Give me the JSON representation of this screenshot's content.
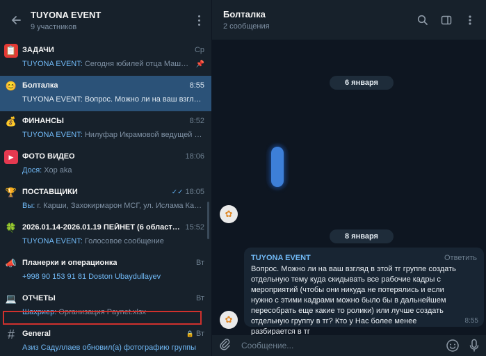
{
  "left_header": {
    "title": "TUYONA EVENT",
    "subtitle": "9 участников"
  },
  "chats": [
    {
      "name": "ЗАДАЧИ",
      "time": "Ср",
      "sender": "TUYONA EVENT:",
      "preview": " Сегодня юбилей отца Машкуро...",
      "icon": "📋",
      "icon_bg": "#e53935"
    },
    {
      "name": "Болталка",
      "time": "8:55",
      "sender": "TUYONA EVENT:",
      "preview": " Вопрос. Можно ли на ваш взгляд...",
      "icon": "😊",
      "icon_bg": "transparent"
    },
    {
      "name": "ФИНАНСЫ",
      "time": "8:52",
      "sender": "TUYONA EVENT:",
      "preview": " Нилуфар Икрамовой ведущей 30...",
      "icon": "💰",
      "icon_bg": "transparent"
    },
    {
      "name": "ФОТО ВИДЕО",
      "time": "18:06",
      "sender": "募ся:",
      "preview": " Хор aka",
      "icon": "▶",
      "icon_bg": "#e53950"
    },
    {
      "name": "ПОСТАВЩИКИ",
      "time": "18:05",
      "sender": "Вы:",
      "preview": " г. Карши, Захокирмарон МСГ, ул. Ислама Кар...",
      "icon": "🏆",
      "icon_bg": "transparent"
    },
    {
      "name": "2026.01.14-2026.01.19 ПЕЙНЕТ (6 областей)",
      "time": "15:52",
      "sender": "TUYONA EVENT:",
      "preview": " Голосовое сообщение",
      "icon": "🍀",
      "icon_bg": "transparent"
    },
    {
      "name": "Планерки и операционка",
      "time": "Вт",
      "sender": "",
      "preview": "+998 90 153 91 81 Doston Ubaydullayev",
      "icon": "📣",
      "icon_bg": "transparent"
    },
    {
      "name": "ОТЧЕТЫ",
      "time": "Вт",
      "sender": "Шахриер:",
      "preview": " Организация Paynet.xlsx",
      "icon": "💻",
      "icon_bg": "transparent"
    },
    {
      "name": "General",
      "time": "Вт",
      "sender": "Азиз Садуллаев обновил(а) фотографию группы",
      "preview": "",
      "icon": "#",
      "icon_bg": "transparent"
    }
  ],
  "chat_header": {
    "title": "Болталка",
    "subtitle": "2 сообщения"
  },
  "dates": [
    "6 января",
    "8 января"
  ],
  "message": {
    "sender": "TUYONA EVENT",
    "reply_label": "Ответить",
    "text": "Вопрос. Можно ли на ваш взгляд в этой тг группе создать отдельную тему куда скидывать все рабочие кадры с мероприятий (чтобы они никуда не потерялись и если нужно с этими кадрами можно было бы в дальнейшем пересобрать еще какие то ролики) или лучше создать отдельную группу в тг? Кто у Нас более менее разбирается в тг",
    "time": "8:55"
  },
  "composer": {
    "placeholder": "Сообщение..."
  },
  "colors": {
    "accent": "#71baf7",
    "active_row": "#2b5278",
    "highlight_box": "#d0312d"
  }
}
